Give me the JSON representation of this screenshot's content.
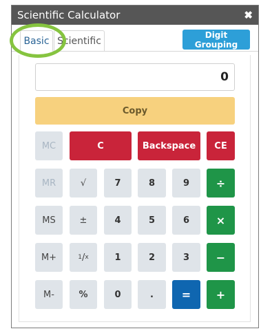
{
  "window": {
    "title": "Scientific Calculator",
    "close_glyph": "✖"
  },
  "tabs": {
    "basic": "Basic",
    "scientific": "Scientific",
    "active": "basic"
  },
  "toolbar": {
    "digit_grouping": "Digit Grouping"
  },
  "display": {
    "value": "0"
  },
  "copy_label": "Copy",
  "memory": {
    "mc": "MC",
    "mr": "MR",
    "ms": "MS",
    "mplus": "M+",
    "mminus": "M-"
  },
  "controls": {
    "clear": "C",
    "backspace": "Backspace",
    "clear_entry": "CE"
  },
  "functions": {
    "sqrt": "√",
    "plusminus": "±",
    "reciprocal_num": "1",
    "reciprocal_den": "x",
    "percent": "%"
  },
  "digits": {
    "d7": "7",
    "d8": "8",
    "d9": "9",
    "d4": "4",
    "d5": "5",
    "d6": "6",
    "d1": "1",
    "d2": "2",
    "d3": "3",
    "d0": "0",
    "dot": "."
  },
  "operators": {
    "divide": "÷",
    "multiply": "×",
    "subtract": "−",
    "add": "+",
    "equals": "="
  },
  "colors": {
    "titlebar": "#565656",
    "digit_grouping": "#2d9fd8",
    "copy": "#f7d17e",
    "red": "#c9243a",
    "green": "#1f9548",
    "blue": "#0f66b0",
    "highlight": "#86c440"
  }
}
